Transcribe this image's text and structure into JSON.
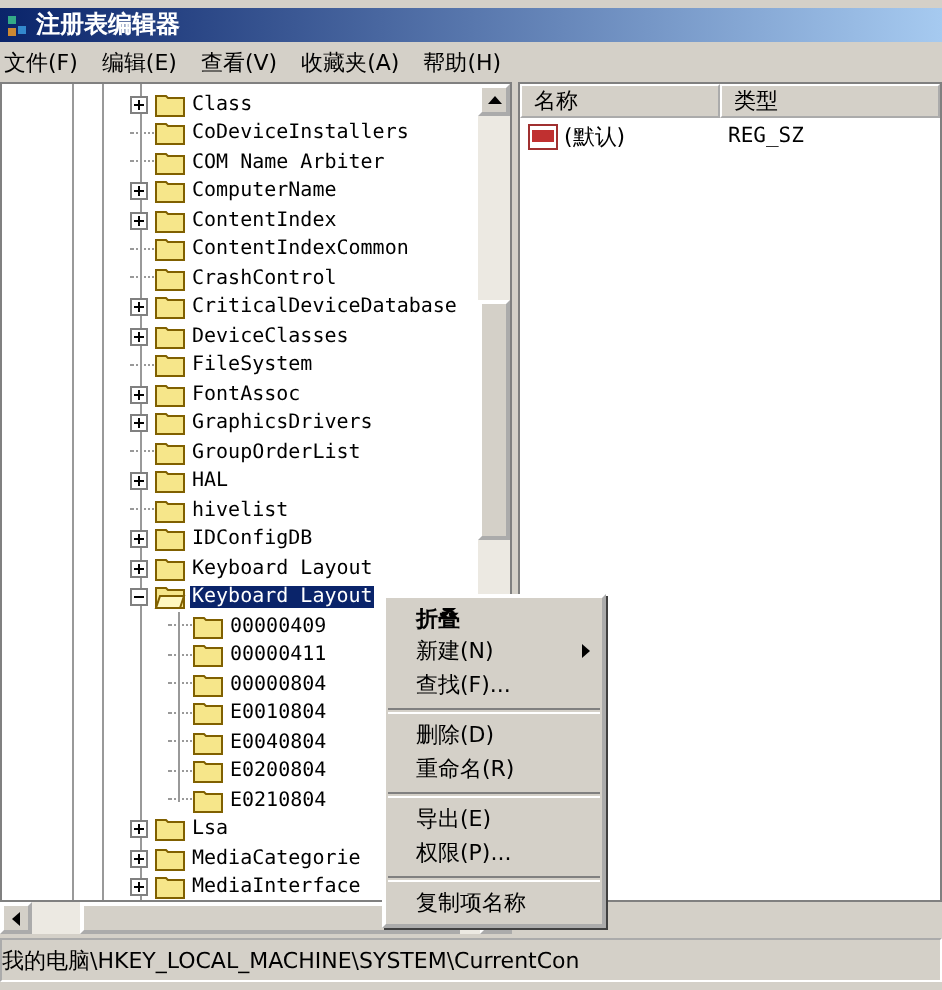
{
  "window": {
    "title": "注册表编辑器"
  },
  "menu_bar": [
    "文件(F)",
    "编辑(E)",
    "查看(V)",
    "收藏夹(A)",
    "帮助(H)"
  ],
  "tree": [
    {
      "label": "Class",
      "has_children": true,
      "expanded": false,
      "selected": false
    },
    {
      "label": "CoDeviceInstallers",
      "has_children": false,
      "expanded": false,
      "selected": false
    },
    {
      "label": "COM Name Arbiter",
      "has_children": false,
      "expanded": false,
      "selected": false
    },
    {
      "label": "ComputerName",
      "has_children": true,
      "expanded": false,
      "selected": false
    },
    {
      "label": "ContentIndex",
      "has_children": true,
      "expanded": false,
      "selected": false
    },
    {
      "label": "ContentIndexCommon",
      "has_children": false,
      "expanded": false,
      "selected": false
    },
    {
      "label": "CrashControl",
      "has_children": false,
      "expanded": false,
      "selected": false
    },
    {
      "label": "CriticalDeviceDatabase",
      "has_children": true,
      "expanded": false,
      "selected": false
    },
    {
      "label": "DeviceClasses",
      "has_children": true,
      "expanded": false,
      "selected": false
    },
    {
      "label": "FileSystem",
      "has_children": false,
      "expanded": false,
      "selected": false
    },
    {
      "label": "FontAssoc",
      "has_children": true,
      "expanded": false,
      "selected": false
    },
    {
      "label": "GraphicsDrivers",
      "has_children": true,
      "expanded": false,
      "selected": false
    },
    {
      "label": "GroupOrderList",
      "has_children": false,
      "expanded": false,
      "selected": false
    },
    {
      "label": "HAL",
      "has_children": true,
      "expanded": false,
      "selected": false
    },
    {
      "label": "hivelist",
      "has_children": false,
      "expanded": false,
      "selected": false
    },
    {
      "label": "IDConfigDB",
      "has_children": true,
      "expanded": false,
      "selected": false
    },
    {
      "label": "Keyboard Layout",
      "has_children": true,
      "expanded": false,
      "selected": false
    },
    {
      "label": "Keyboard Layout",
      "has_children": true,
      "expanded": true,
      "selected": true,
      "children": [
        {
          "label": "00000409",
          "has_children": false,
          "expanded": false,
          "selected": false
        },
        {
          "label": "00000411",
          "has_children": false,
          "expanded": false,
          "selected": false
        },
        {
          "label": "00000804",
          "has_children": false,
          "expanded": false,
          "selected": false
        },
        {
          "label": "E0010804",
          "has_children": false,
          "expanded": false,
          "selected": false
        },
        {
          "label": "E0040804",
          "has_children": false,
          "expanded": false,
          "selected": false
        },
        {
          "label": "E0200804",
          "has_children": false,
          "expanded": false,
          "selected": false
        },
        {
          "label": "E0210804",
          "has_children": false,
          "expanded": false,
          "selected": false
        }
      ]
    },
    {
      "label": "Lsa",
      "has_children": true,
      "expanded": false,
      "selected": false
    },
    {
      "label": "MediaCategorie",
      "has_children": true,
      "expanded": false,
      "selected": false
    },
    {
      "label": "MediaInterface",
      "has_children": true,
      "expanded": false,
      "selected": false
    }
  ],
  "values": {
    "columns": [
      "名称",
      "类型"
    ],
    "rows": [
      {
        "name": "(默认)",
        "type": "REG_SZ"
      }
    ]
  },
  "context_menu": [
    {
      "kind": "item",
      "label": "折叠",
      "bold": true,
      "submenu": false
    },
    {
      "kind": "item",
      "label": "新建(N)",
      "bold": false,
      "submenu": true
    },
    {
      "kind": "item",
      "label": "查找(F)...",
      "bold": false,
      "submenu": false
    },
    {
      "kind": "separator"
    },
    {
      "kind": "item",
      "label": "删除(D)",
      "bold": false,
      "submenu": false
    },
    {
      "kind": "item",
      "label": "重命名(R)",
      "bold": false,
      "submenu": false
    },
    {
      "kind": "separator"
    },
    {
      "kind": "item",
      "label": "导出(E)",
      "bold": false,
      "submenu": false
    },
    {
      "kind": "item",
      "label": "权限(P)...",
      "bold": false,
      "submenu": false
    },
    {
      "kind": "separator"
    },
    {
      "kind": "item",
      "label": "复制项名称",
      "bold": false,
      "submenu": false
    }
  ],
  "status_bar": "我的电脑\\HKEY_LOCAL_MACHINE\\SYSTEM\\CurrentCon"
}
